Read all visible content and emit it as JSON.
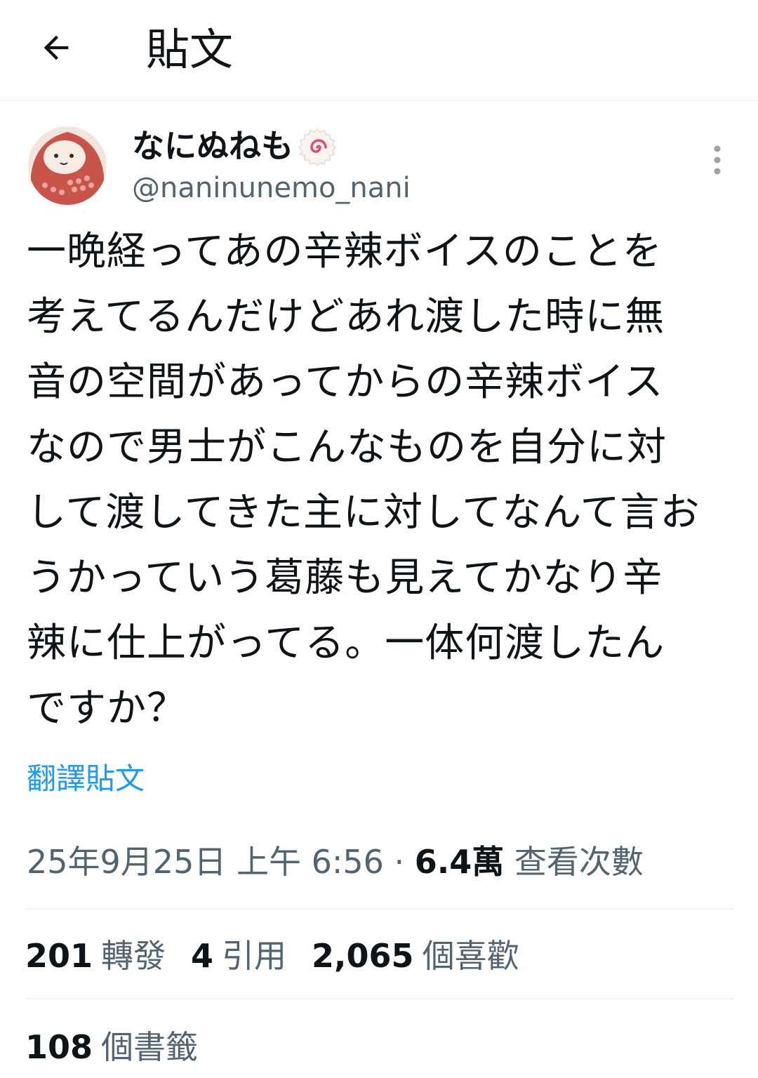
{
  "header": {
    "title": "貼文"
  },
  "tweet": {
    "display_name": "なにぬねも",
    "name_badge": "naruto-fishcake-emoji",
    "handle": "@naninunemo_nani",
    "text": "一晩経ってあの辛辣ボイスのことを\n考えてるんだけどあれ渡した時に無\n音の空間があってからの辛辣ボイス\nなので男士がこんなものを自分に対\nして渡してきた主に対してなんて言お\nうかっていう葛藤も見えてかなり辛\n辣に仕上がってる。一体何渡したん\nですか？",
    "translate_label": "翻譯貼文",
    "timestamp": "25年9月25日 上午 6:56",
    "separator": " · ",
    "views_count": "6.4萬",
    "views_label": "查看次數"
  },
  "stats": {
    "retweets_count": "201",
    "retweets_label": "轉發",
    "quotes_count": "4",
    "quotes_label": "引用",
    "likes_count": "2,065",
    "likes_label": "個喜歡",
    "bookmarks_count": "108",
    "bookmarks_label": "個書籤"
  },
  "colors": {
    "link": "#1d9bf0",
    "secondary_text": "#536471",
    "primary_text": "#0f1419",
    "divider": "#eff3f4",
    "avatar_bg": "#c9544a"
  },
  "icons": {
    "back": "arrow-left-icon",
    "more": "more-vertical-icon"
  }
}
